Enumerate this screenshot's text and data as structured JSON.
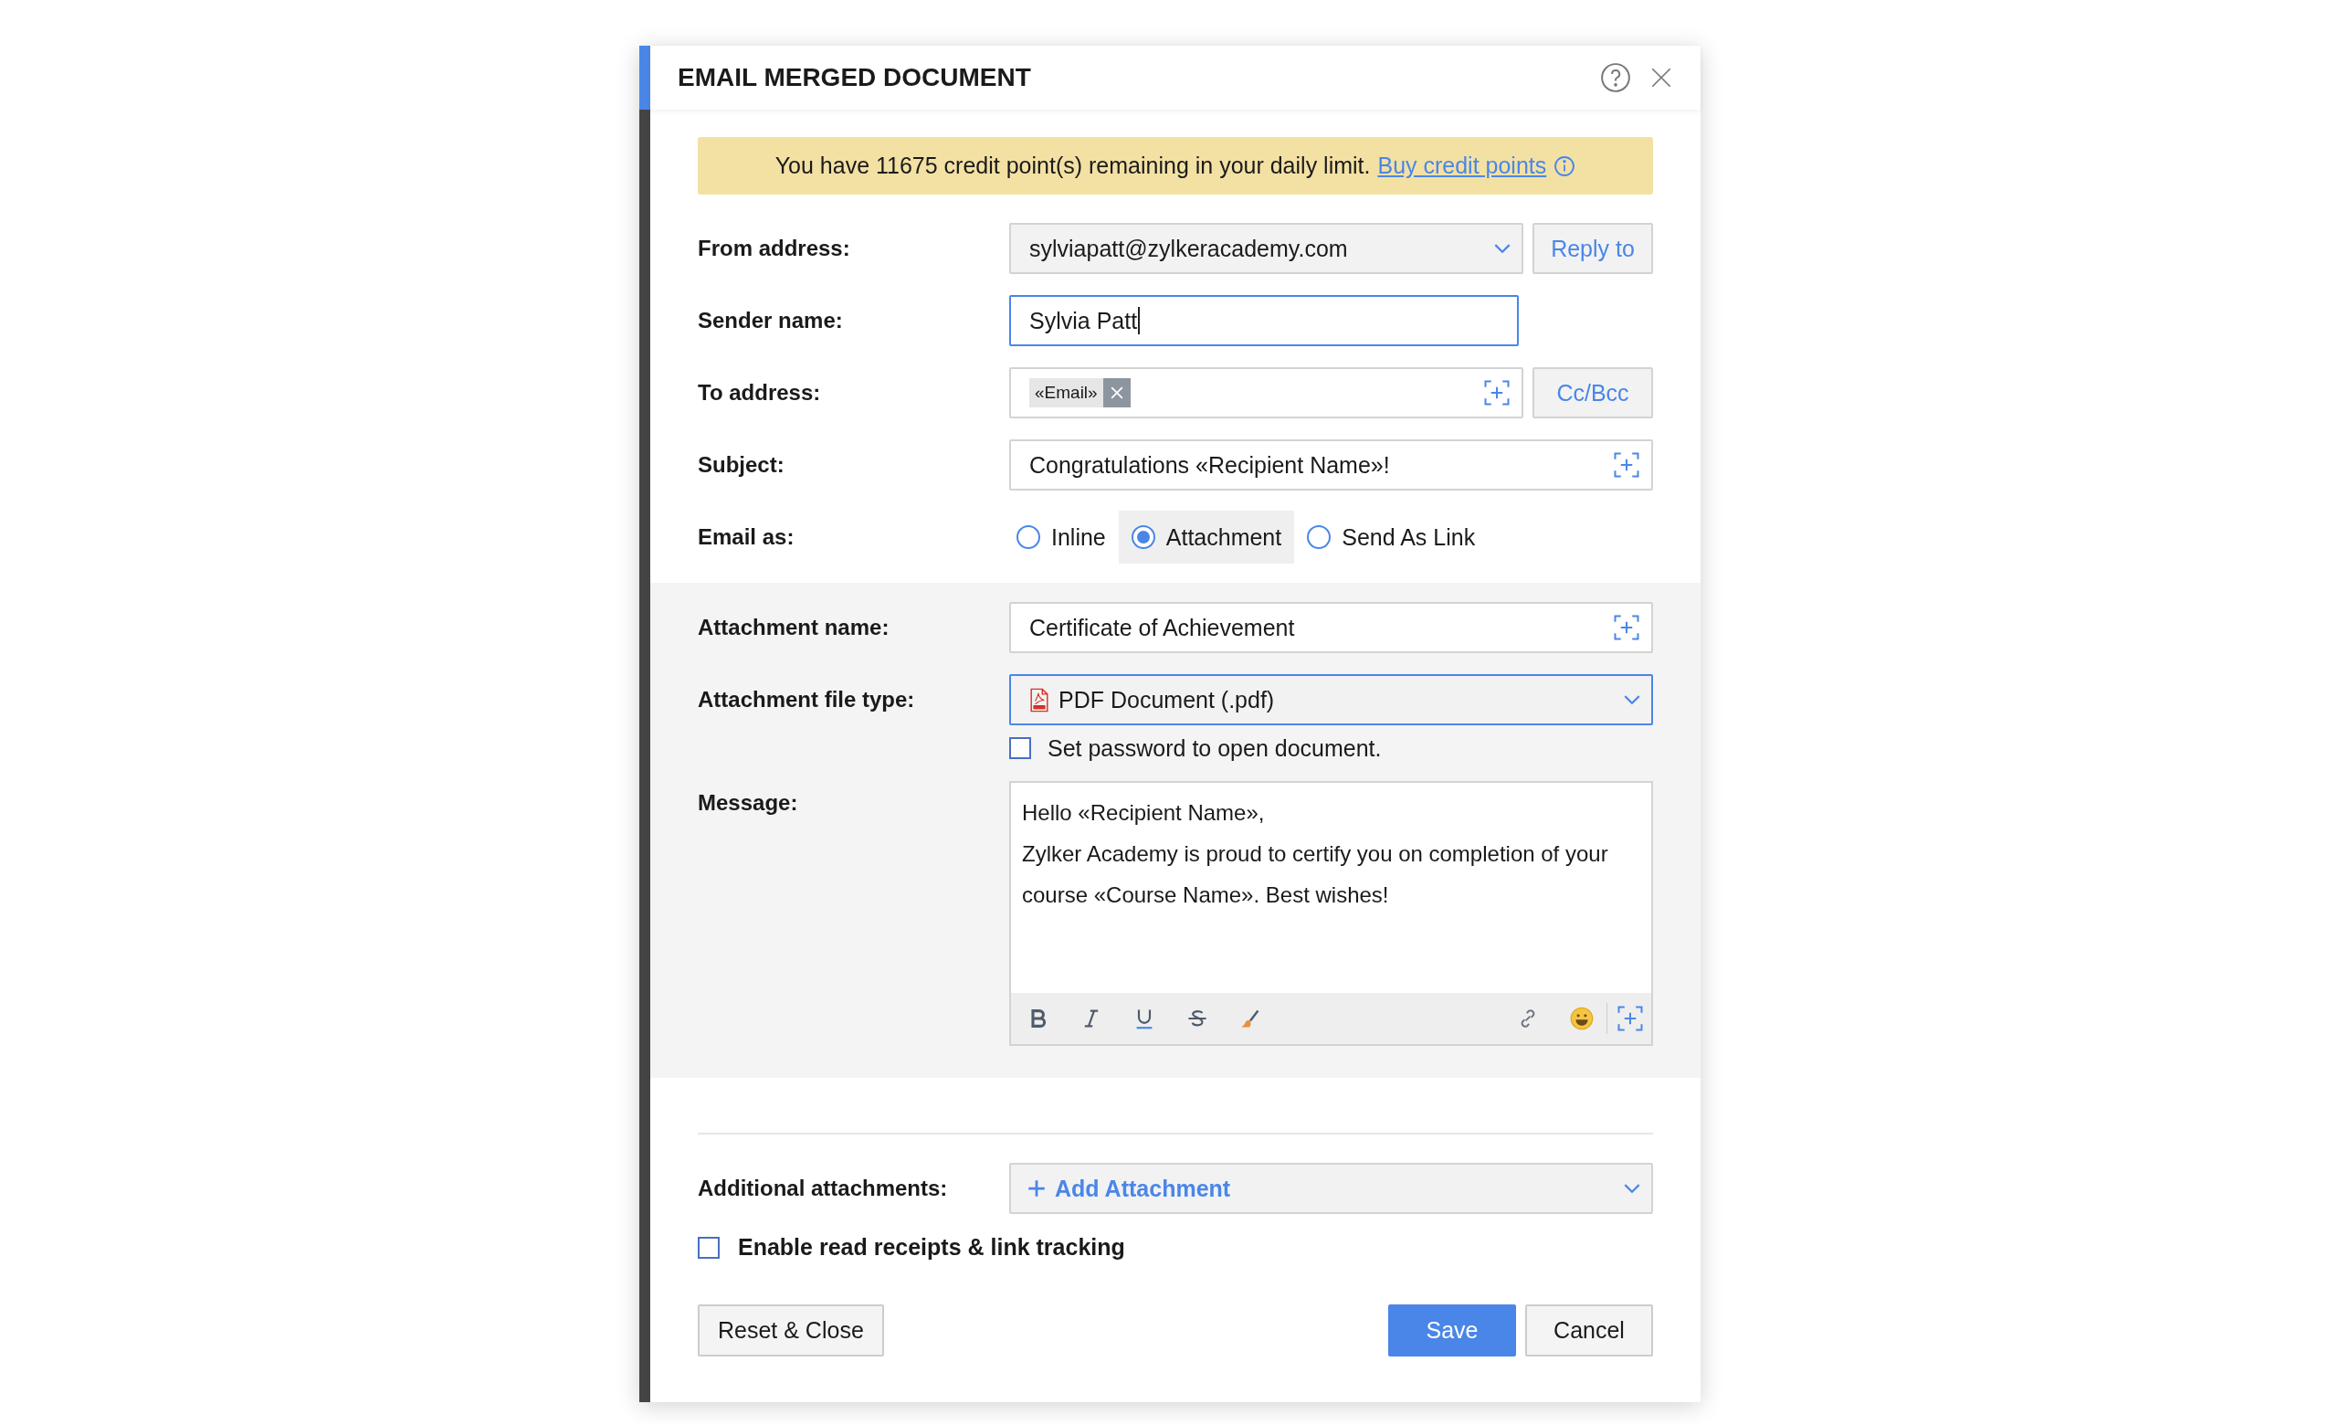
{
  "dialog": {
    "title": "EMAIL MERGED DOCUMENT"
  },
  "notice": {
    "text": "You have 11675 credit point(s) remaining in your daily limit.",
    "link": "Buy credit points"
  },
  "from_address": {
    "label": "From address:",
    "value": "sylviapatt@zylkeracademy.com",
    "button": "Reply to"
  },
  "sender_name": {
    "label": "Sender name:",
    "value": "Sylvia Patt",
    "focused": true
  },
  "to_address": {
    "label": "To address:",
    "tokens": [
      "«Email»"
    ],
    "button": "Cc/Bcc"
  },
  "subject": {
    "label": "Subject:",
    "value": "Congratulations «Recipient Name»!"
  },
  "email_as": {
    "label": "Email as:",
    "options": [
      {
        "label": "Inline",
        "selected": false
      },
      {
        "label": "Attachment",
        "selected": true
      },
      {
        "label": "Send As Link",
        "selected": false
      }
    ]
  },
  "attachment_name": {
    "label": "Attachment name:",
    "value": "Certificate of Achievement"
  },
  "attachment_file_type": {
    "label": "Attachment file type:",
    "value": "PDF Document (.pdf)",
    "focused": true
  },
  "password_option": {
    "label": "Set password to open document.",
    "checked": false
  },
  "message": {
    "label": "Message:",
    "paragraphs": [
      "Hello «Recipient Name»,",
      "Zylker Academy is proud to certify you on completion of your course «Course Name». Best wishes!"
    ]
  },
  "additional_attachments": {
    "label": "Additional attachments:",
    "button": "Add Attachment"
  },
  "read_receipts": {
    "label": "Enable read receipts & link tracking",
    "checked": false
  },
  "buttons": {
    "reset": "Reset & Close",
    "save": "Save",
    "cancel": "Cancel"
  }
}
